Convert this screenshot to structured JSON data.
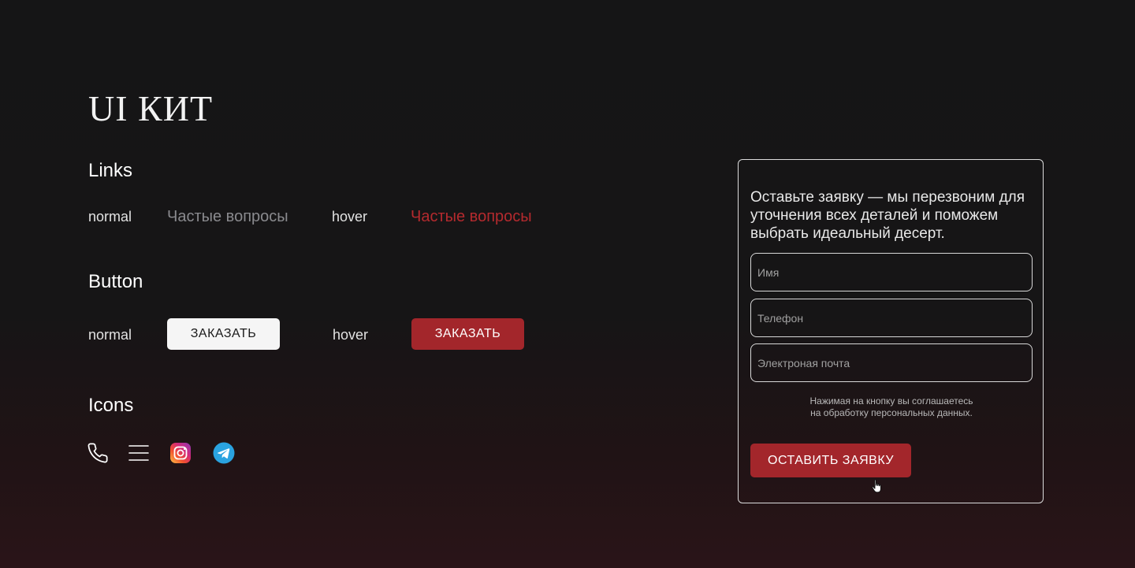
{
  "page": {
    "title": "UI КИТ"
  },
  "links": {
    "title": "Links",
    "normal_label": "normal",
    "normal_link": "Частые вопросы",
    "hover_label": "hover",
    "hover_link": "Частые вопросы",
    "colors": {
      "normal": "#8a8a8e",
      "hover": "#b52a2e"
    }
  },
  "button": {
    "title": "Button",
    "normal_label": "normal",
    "normal_button": "ЗАКАЗАТЬ",
    "hover_label": "hover",
    "hover_button": "ЗАКАЗАТЬ",
    "colors": {
      "normal_bg": "#f5f5f5",
      "hover_bg": "#a3262b"
    }
  },
  "icons": {
    "title": "Icons",
    "items": [
      "phone-icon",
      "menu-icon",
      "instagram-icon",
      "telegram-icon"
    ]
  },
  "form": {
    "heading": "Оставьте заявку — мы перезвоним для уточнения всех деталей и поможем выбрать идеальный десерт.",
    "fields": [
      {
        "placeholder": "Имя"
      },
      {
        "placeholder": "Телефон"
      },
      {
        "placeholder": "Электроная почта"
      }
    ],
    "consent_line1": "Нажимая на кнопку вы соглашаетесь",
    "consent_line2": "на обработку персональных данных.",
    "submit_label": "ОСТАВИТЬ ЗАЯВКУ",
    "accent_color": "#a3262b"
  }
}
